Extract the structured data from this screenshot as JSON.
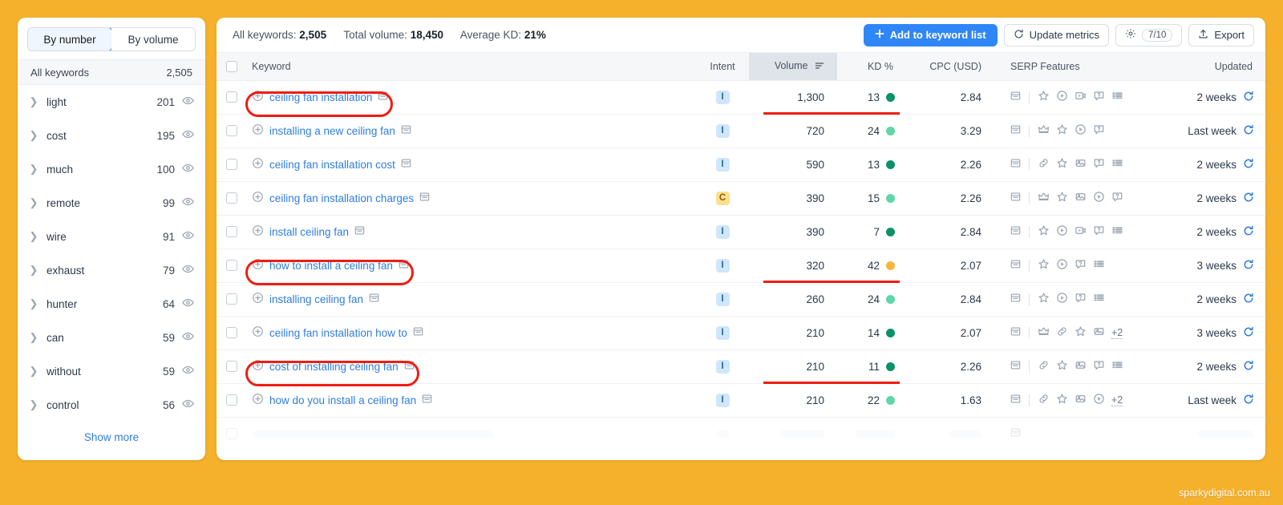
{
  "sidebar": {
    "toggle": {
      "by_number": "By number",
      "by_volume": "By volume",
      "active": "By number"
    },
    "all_keywords_label": "All keywords",
    "all_keywords_count": "2,505",
    "groups": [
      {
        "label": "light",
        "count": "201"
      },
      {
        "label": "cost",
        "count": "195"
      },
      {
        "label": "much",
        "count": "100"
      },
      {
        "label": "remote",
        "count": "99"
      },
      {
        "label": "wire",
        "count": "91"
      },
      {
        "label": "exhaust",
        "count": "79"
      },
      {
        "label": "hunter",
        "count": "64"
      },
      {
        "label": "can",
        "count": "59"
      },
      {
        "label": "without",
        "count": "59"
      },
      {
        "label": "control",
        "count": "56"
      }
    ],
    "show_more": "Show more"
  },
  "header": {
    "all_keywords_label": "All keywords:",
    "all_keywords_value": "2,505",
    "total_volume_label": "Total volume:",
    "total_volume_value": "18,450",
    "average_kd_label": "Average KD:",
    "average_kd_value": "21%",
    "add_to_list": "Add to keyword list",
    "update_metrics": "Update metrics",
    "settings_counter": "7/10",
    "export": "Export"
  },
  "table": {
    "columns": {
      "keyword": "Keyword",
      "intent": "Intent",
      "volume": "Volume",
      "kd": "KD %",
      "cpc": "CPC (USD)",
      "serp": "SERP Features",
      "updated": "Updated"
    },
    "sorted_column": "Volume",
    "rows": [
      {
        "keyword": "ceiling fan installation",
        "intent": "I",
        "volume": "1,300",
        "kd": "13",
        "kd_color": "#099268",
        "cpc": "2.84",
        "serp": [
          "star",
          "play-circle",
          "video",
          "faq",
          "list"
        ],
        "overflow": "",
        "updated": "2 weeks",
        "highlight": true
      },
      {
        "keyword": "installing a new ceiling fan",
        "intent": "I",
        "volume": "720",
        "kd": "24",
        "kd_color": "#5fd6a6",
        "cpc": "3.29",
        "serp": [
          "crown",
          "star",
          "play-circle",
          "faq"
        ],
        "overflow": "",
        "updated": "Last week",
        "highlight": false
      },
      {
        "keyword": "ceiling fan installation cost",
        "intent": "I",
        "volume": "590",
        "kd": "13",
        "kd_color": "#099268",
        "cpc": "2.26",
        "serp": [
          "link",
          "star",
          "image",
          "faq",
          "list"
        ],
        "overflow": "",
        "updated": "2 weeks",
        "highlight": false
      },
      {
        "keyword": "ceiling fan installation charges",
        "intent": "C",
        "volume": "390",
        "kd": "15",
        "kd_color": "#5fd6a6",
        "cpc": "2.26",
        "serp": [
          "crown",
          "star",
          "image",
          "play-circle",
          "faq"
        ],
        "overflow": "",
        "updated": "2 weeks",
        "highlight": false
      },
      {
        "keyword": "install ceiling fan",
        "intent": "I",
        "volume": "390",
        "kd": "7",
        "kd_color": "#099268",
        "cpc": "2.84",
        "serp": [
          "star",
          "play-circle",
          "video",
          "faq",
          "list"
        ],
        "overflow": "",
        "updated": "2 weeks",
        "highlight": false
      },
      {
        "keyword": "how to install a ceiling fan",
        "intent": "I",
        "volume": "320",
        "kd": "42",
        "kd_color": "#f9b53a",
        "cpc": "2.07",
        "serp": [
          "star",
          "play-circle",
          "faq",
          "list"
        ],
        "overflow": "",
        "updated": "3 weeks",
        "highlight": true
      },
      {
        "keyword": "installing ceiling fan",
        "intent": "I",
        "volume": "260",
        "kd": "24",
        "kd_color": "#5fd6a6",
        "cpc": "2.84",
        "serp": [
          "star",
          "play-circle",
          "faq",
          "list"
        ],
        "overflow": "",
        "updated": "2 weeks",
        "highlight": false
      },
      {
        "keyword": "ceiling fan installation how to",
        "intent": "I",
        "volume": "210",
        "kd": "14",
        "kd_color": "#099268",
        "cpc": "2.07",
        "serp": [
          "crown",
          "link",
          "star",
          "image"
        ],
        "overflow": "+2",
        "updated": "3 weeks",
        "highlight": false
      },
      {
        "keyword": "cost of installing ceiling fan",
        "intent": "I",
        "volume": "210",
        "kd": "11",
        "kd_color": "#099268",
        "cpc": "2.26",
        "serp": [
          "link",
          "star",
          "image",
          "faq",
          "list"
        ],
        "overflow": "",
        "updated": "2 weeks",
        "highlight": true
      },
      {
        "keyword": "how do you install a ceiling fan",
        "intent": "I",
        "volume": "210",
        "kd": "22",
        "kd_color": "#5fd6a6",
        "cpc": "1.63",
        "serp": [
          "link",
          "star",
          "image",
          "play-circle"
        ],
        "overflow": "+2",
        "updated": "Last week",
        "highlight": false
      }
    ]
  },
  "watermark": "sparkydigital.com.au",
  "colors": {
    "background": "#f5b12c",
    "accent_blue": "#2f86f6",
    "link_blue": "#2f7de1",
    "highlight_red": "#ee1d11"
  }
}
